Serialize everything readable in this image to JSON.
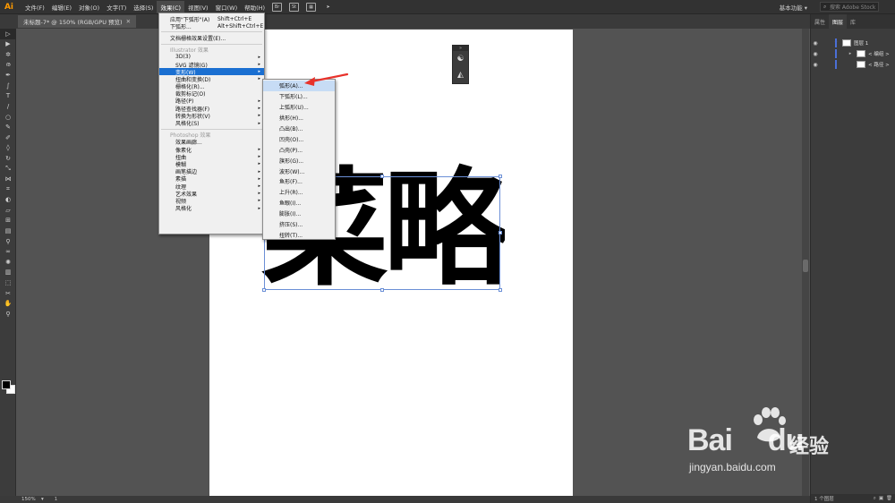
{
  "app": {
    "logo": "Ai",
    "menus": [
      "文件(F)",
      "编辑(E)",
      "对象(O)",
      "文字(T)",
      "选择(S)",
      "效果(C)",
      "视图(V)",
      "窗口(W)",
      "帮助(H)"
    ],
    "menubar_icons": [
      "Br",
      "St"
    ],
    "workspace": "基本功能 ▾",
    "stock_search_placeholder": "搜索 Adobe Stock"
  },
  "document": {
    "tab_title": "未标题-7* @ 150% (RGB/GPU 预览)",
    "tab_close": "✕",
    "artwork_text": "菜略"
  },
  "effect_menu": {
    "apply_last": "应用\"下弧形\"(A)",
    "apply_last_shortcut": "Shift+Ctrl+E",
    "last_effect": "下弧形...",
    "last_effect_shortcut": "Alt+Shift+Ctrl+E",
    "raster_settings": "文档栅格效果设置(E)...",
    "illustrator_section": "Illustrator 效果",
    "illustrator_items": [
      "3D(3)",
      "SVG 滤镜(G)",
      "变形(W)",
      "扭曲和变换(D)",
      "栅格化(R)...",
      "裁剪标记(O)",
      "路径(P)",
      "路径查找器(F)",
      "转换为形状(V)",
      "风格化(S)"
    ],
    "photoshop_section": "Photoshop 效果",
    "photoshop_items": [
      "效果画廊...",
      "像素化",
      "扭曲",
      "模糊",
      "画笔描边",
      "素描",
      "纹理",
      "艺术效果",
      "视频",
      "风格化"
    ]
  },
  "warp_menu": {
    "items": [
      "弧形(A)...",
      "下弧形(L)...",
      "上弧形(U)...",
      "拱形(H)...",
      "凸出(B)...",
      "凹壳(O)...",
      "凸壳(P)...",
      "旗形(G)...",
      "波形(W)...",
      "鱼形(F)...",
      "上升(R)...",
      "鱼眼(I)...",
      "膨胀(I)...",
      "挤压(S)...",
      "扭转(T)..."
    ]
  },
  "right_panel": {
    "tabs": [
      "属性",
      "图层",
      "库"
    ],
    "layers": [
      {
        "name": "图层 1"
      },
      {
        "name": "< 编组 >"
      },
      {
        "name": "< 路径 >"
      }
    ],
    "footer": "1 个图层"
  },
  "status": {
    "zoom": "150%",
    "page": "1"
  },
  "watermark": {
    "brand": "Bai",
    "brand_tail": "du",
    "cn": "经验",
    "url": "jingyan.baidu.com"
  }
}
